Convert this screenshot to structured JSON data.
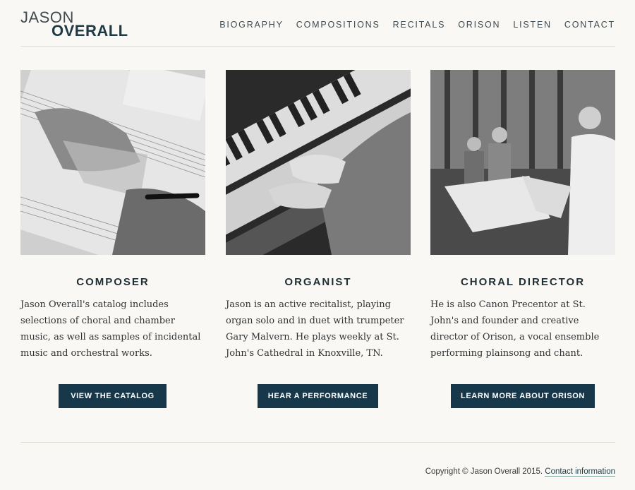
{
  "header": {
    "logo_line1": "JASON",
    "logo_line2": "OVERALL",
    "nav": [
      "BIOGRAPHY",
      "COMPOSITIONS",
      "RECITALS",
      "ORISON",
      "LISTEN",
      "CONTACT"
    ]
  },
  "columns": [
    {
      "title": "COMPOSER",
      "text": "Jason Overall's catalog includes selections of choral and chamber music, as well as samples of incidental music and orchestral works.",
      "button": "VIEW THE CATALOG"
    },
    {
      "title": "ORGANIST",
      "text": "Jason is an active recitalist, playing organ solo and in duet with trumpeter Gary Malvern. He plays weekly at St. John's Cathedral in Knoxville, TN.",
      "button": "HEAR A PERFORMANCE"
    },
    {
      "title": "CHORAL DIRECTOR",
      "text": "He is also Canon Precentor at St. John's and founder and creative director of Orison, a vocal ensemble performing plainsong and chant.",
      "button": "LEARN MORE ABOUT ORISON"
    }
  ],
  "footer": {
    "copyright": "Copyright © Jason Overall 2015.",
    "link": "Contact information"
  },
  "colors": {
    "background": "#faf8f4",
    "button": "#17384a",
    "logo": "#1f3a44"
  }
}
